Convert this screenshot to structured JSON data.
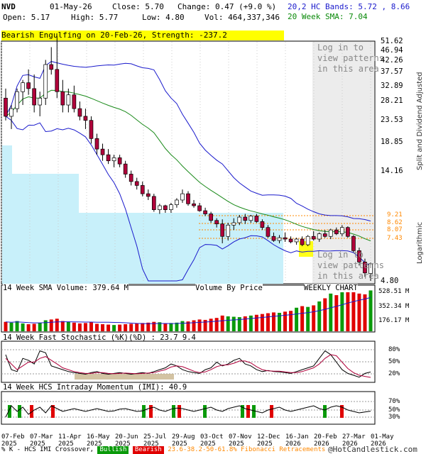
{
  "header": {
    "symbol": "NVD",
    "date": "01-May-26",
    "close": "Close: 5.70",
    "change": "Change: 0.47 (+9.0 %)",
    "open": "Open: 5.17",
    "high": "High: 5.77",
    "low": "Low: 4.80",
    "vol": "Vol: 464,337,346",
    "bands": "20,2 HC Bands: 5.72 , 8.66",
    "sma": "20 Week SMA: 7.04"
  },
  "banner": "Bearish Engulfing on 20-Feb-26, Strength: -237.2",
  "locked_text": [
    "Log in to",
    "view patterns",
    "in this area"
  ],
  "side_label_top": "Split and Dividend Adjusted",
  "side_label_log": "Logarithmic",
  "price_axis": [
    "51.62",
    "46.94",
    "42.26",
    "37.57",
    "32.89",
    "28.21",
    "23.53",
    "18.85",
    "14.16",
    "9.21",
    "8.62",
    "8.07",
    "7.43",
    "4.80"
  ],
  "colors": {
    "up": "#ffffff",
    "down": "#b0003a",
    "band": "#1a1acc",
    "sma": "#1a8a1a",
    "vbp": "#c8f0fa",
    "fib": "#ff8800"
  },
  "volume_panel": {
    "title": "14 Week SMA Volume: 379.64 M",
    "vbp_label": "Volume By Price",
    "weekly_label": "WEEKLY CHART",
    "axis": [
      "528.51 M",
      "352.34 M",
      "176.17 M"
    ]
  },
  "stoch_panel": {
    "title": "14 Week Fast Stochastic (%K)(%D) : 23.7  9.4",
    "axis": [
      "80%",
      "50%",
      "20%"
    ]
  },
  "imi_panel": {
    "title": "14 Week HCS Intraday Momentum (IMI): 40.9",
    "axis": [
      "70%",
      "50%",
      "30%"
    ]
  },
  "x_axis": [
    {
      "top": "07-Feb",
      "bottom": "2025"
    },
    {
      "top": "07-Mar",
      "bottom": "2025"
    },
    {
      "top": "11-Apr",
      "bottom": "2025"
    },
    {
      "top": "16-May",
      "bottom": "2025"
    },
    {
      "top": "20-Jun",
      "bottom": "2025"
    },
    {
      "top": "25-Jul",
      "bottom": "2025"
    },
    {
      "top": "29-Aug",
      "bottom": "2025"
    },
    {
      "top": "03-Oct",
      "bottom": "2025"
    },
    {
      "top": "07-Nov",
      "bottom": "2025"
    },
    {
      "top": "12-Dec",
      "bottom": "2025"
    },
    {
      "top": "16-Jan",
      "bottom": "2026"
    },
    {
      "top": "20-Feb",
      "bottom": "2026"
    },
    {
      "top": "27-Mar",
      "bottom": "2026"
    },
    {
      "top": "01-May",
      "bottom": "2026"
    }
  ],
  "footer": {
    "left": "% K - HCS IMI Crossover,",
    "bull": "Bullish",
    "bear": "Bearish",
    "fib": "23.6-38.2-50-61.8% Fibonacci Retracements",
    "right": "@HotCandlestick.com"
  },
  "chart_data": {
    "type": "candlestick",
    "scale": "log",
    "ylim": [
      4.8,
      51.62
    ],
    "weeks": 65,
    "ohlc": [
      [
        30,
        33,
        24,
        25
      ],
      [
        25,
        28,
        22,
        27
      ],
      [
        27,
        33,
        26,
        32
      ],
      [
        32,
        36,
        28,
        35
      ],
      [
        35,
        40,
        31,
        33
      ],
      [
        33,
        38,
        26,
        28
      ],
      [
        28,
        32,
        25,
        30
      ],
      [
        30,
        44,
        28,
        42
      ],
      [
        42,
        50,
        38,
        40
      ],
      [
        40,
        56,
        30,
        32
      ],
      [
        32,
        36,
        26,
        28
      ],
      [
        28,
        33,
        26,
        31
      ],
      [
        31,
        34,
        26,
        27
      ],
      [
        27,
        29,
        24,
        25
      ],
      [
        25,
        27,
        22,
        24
      ],
      [
        24,
        25,
        19,
        20
      ],
      [
        20,
        21,
        17,
        18
      ],
      [
        18,
        19,
        16,
        17
      ],
      [
        17,
        18,
        15.5,
        16
      ],
      [
        16,
        17,
        15,
        16.5
      ],
      [
        16.5,
        17,
        15,
        15.5
      ],
      [
        15.5,
        16,
        13.5,
        14
      ],
      [
        14,
        14.5,
        12.5,
        13
      ],
      [
        13,
        13.5,
        12,
        12.5
      ],
      [
        12.5,
        13,
        11.2,
        11.5
      ],
      [
        11.5,
        12,
        10.8,
        11.2
      ],
      [
        11.2,
        11.5,
        9.6,
        9.8
      ],
      [
        9.8,
        10.4,
        9.4,
        10.2
      ],
      [
        10.2,
        10.3,
        9.5,
        9.8
      ],
      [
        9.8,
        10.5,
        9.5,
        10.3
      ],
      [
        10.3,
        11,
        10,
        10.8
      ],
      [
        10.8,
        12,
        10.5,
        11.5
      ],
      [
        11.5,
        11.8,
        10.2,
        10.4
      ],
      [
        10.4,
        10.8,
        10,
        10.2
      ],
      [
        10.2,
        10.5,
        9.6,
        9.7
      ],
      [
        9.7,
        10,
        9.2,
        9.4
      ],
      [
        9.4,
        9.6,
        8.6,
        8.8
      ],
      [
        8.8,
        9,
        8.2,
        8.5
      ],
      [
        8.5,
        8.9,
        7.0,
        7.5
      ],
      [
        7.5,
        8.6,
        7.2,
        8.4
      ],
      [
        8.4,
        9.0,
        8.0,
        8.6
      ],
      [
        8.6,
        9.3,
        8.4,
        9.1
      ],
      [
        9.1,
        9.4,
        8.5,
        8.8
      ],
      [
        8.8,
        9.3,
        8.6,
        9.2
      ],
      [
        9.2,
        9.4,
        8.6,
        8.7
      ],
      [
        8.7,
        8.9,
        8.0,
        8.2
      ],
      [
        8.2,
        8.4,
        7.4,
        7.5
      ],
      [
        7.5,
        7.8,
        7.1,
        7.2
      ],
      [
        7.2,
        7.6,
        7.0,
        7.4
      ],
      [
        7.4,
        7.8,
        7.1,
        7.3
      ],
      [
        7.3,
        7.5,
        7.0,
        7.1
      ],
      [
        7.1,
        7.4,
        6.9,
        7.3
      ],
      [
        7.3,
        7.5,
        6.8,
        6.9
      ],
      [
        6.9,
        7.6,
        6.8,
        7.5
      ],
      [
        7.5,
        7.9,
        7.2,
        7.3
      ],
      [
        7.3,
        7.8,
        7.1,
        7.7
      ],
      [
        7.7,
        8.0,
        7.4,
        7.5
      ],
      [
        7.5,
        8.1,
        7.3,
        8.0
      ],
      [
        8.0,
        8.2,
        7.6,
        7.7
      ],
      [
        7.7,
        8.4,
        7.5,
        8.2
      ],
      [
        8.2,
        8.3,
        7.4,
        7.5
      ],
      [
        7.5,
        7.6,
        6.4,
        6.5
      ],
      [
        6.5,
        6.7,
        5.6,
        5.8
      ],
      [
        5.8,
        6.0,
        5.0,
        5.2
      ],
      [
        5.17,
        5.77,
        4.8,
        5.7
      ]
    ],
    "volume": [
      120,
      110,
      130,
      100,
      90,
      95,
      105,
      140,
      150,
      160,
      130,
      120,
      110,
      100,
      105,
      115,
      95,
      90,
      85,
      80,
      85,
      90,
      95,
      100,
      105,
      110,
      120,
      115,
      100,
      105,
      110,
      130,
      125,
      140,
      150,
      145,
      160,
      170,
      200,
      190,
      185,
      180,
      190,
      200,
      210,
      220,
      230,
      240,
      235,
      250,
      260,
      300,
      320,
      310,
      330,
      380,
      420,
      480,
      460,
      520,
      528,
      500,
      480,
      470,
      520
    ],
    "stoch_k": [
      70,
      30,
      25,
      60,
      55,
      45,
      80,
      75,
      40,
      35,
      30,
      25,
      22,
      20,
      18,
      22,
      25,
      20,
      18,
      20,
      22,
      20,
      18,
      20,
      22,
      20,
      25,
      30,
      35,
      45,
      40,
      30,
      25,
      22,
      20,
      30,
      35,
      50,
      40,
      45,
      55,
      60,
      45,
      40,
      30,
      25,
      28,
      25,
      24,
      22,
      20,
      25,
      30,
      35,
      40,
      60,
      80,
      70,
      50,
      30,
      20,
      15,
      10,
      20,
      23.7
    ],
    "stoch_d": [
      60,
      45,
      30,
      40,
      50,
      50,
      60,
      65,
      55,
      45,
      35,
      30,
      25,
      22,
      20,
      20,
      22,
      22,
      20,
      19,
      20,
      21,
      20,
      19,
      20,
      21,
      22,
      26,
      30,
      37,
      40,
      38,
      32,
      26,
      22,
      24,
      30,
      38,
      42,
      43,
      47,
      53,
      53,
      48,
      38,
      30,
      27,
      26,
      26,
      24,
      22,
      22,
      25,
      30,
      35,
      45,
      60,
      70,
      67,
      50,
      33,
      22,
      15,
      12,
      9.4
    ],
    "imi": [
      20,
      60,
      40,
      55,
      30,
      45,
      55,
      35,
      60,
      50,
      40,
      45,
      50,
      45,
      40,
      45,
      50,
      45,
      40,
      42,
      48,
      50,
      45,
      40,
      42,
      50,
      55,
      45,
      40,
      48,
      52,
      50,
      45,
      40,
      45,
      50,
      55,
      45,
      40,
      50,
      55,
      60,
      50,
      45,
      40,
      35,
      45,
      50,
      55,
      45,
      40,
      45,
      50,
      55,
      60,
      50,
      45,
      55,
      60,
      55,
      45,
      40,
      35,
      38,
      40.9
    ]
  }
}
